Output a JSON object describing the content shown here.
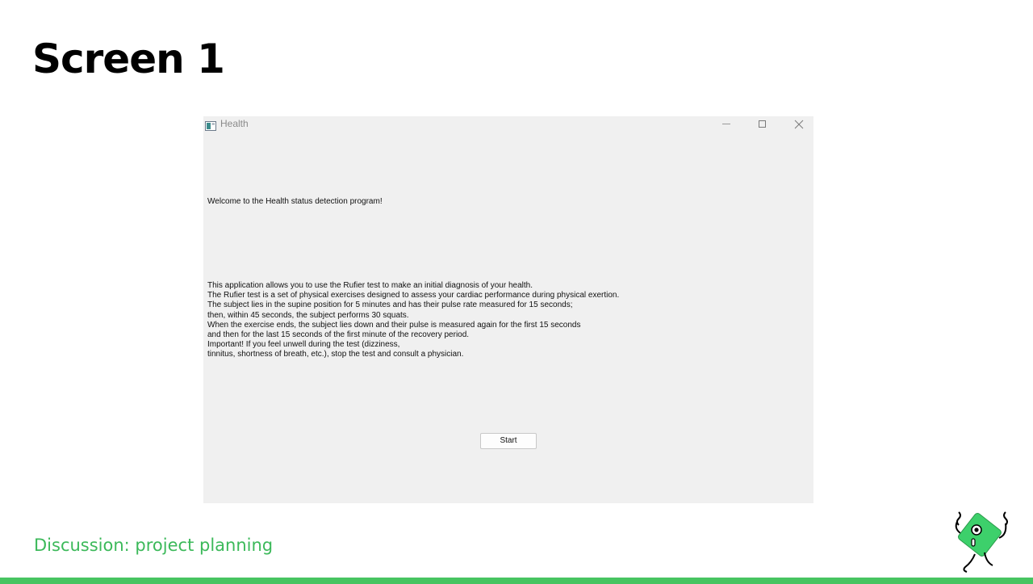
{
  "slide": {
    "title": "Screen 1",
    "footer_caption": "Discussion: project planning",
    "accent_color": "#3cb95a"
  },
  "window": {
    "title": "Health",
    "icon": "app-window-icon",
    "controls": {
      "minimize_icon": "minimize-icon",
      "maximize_icon": "maximize-icon",
      "close_icon": "close-icon"
    },
    "background_color": "#f0f0f0"
  },
  "content": {
    "welcome": "Welcome to the Health status detection program!",
    "instructions": [
      "This application allows you to use the Rufier test to make an initial diagnosis of your health.",
      "The Rufier test is a set of physical exercises designed to assess your cardiac performance during physical exertion.",
      "The subject lies in the supine position for 5 minutes and has their pulse rate measured for 15 seconds;",
      "then, within 45 seconds, the subject performs 30 squats.",
      "When the exercise ends, the subject lies down and their pulse is measured again for the first 15 seconds",
      "and then for the last 15 seconds of the first minute of the recovery period.",
      "Important! If you feel unwell during the test (dizziness,",
      "tinnitus, shortness of breath, etc.), stop the test and consult a physician."
    ],
    "start_label": "Start"
  }
}
